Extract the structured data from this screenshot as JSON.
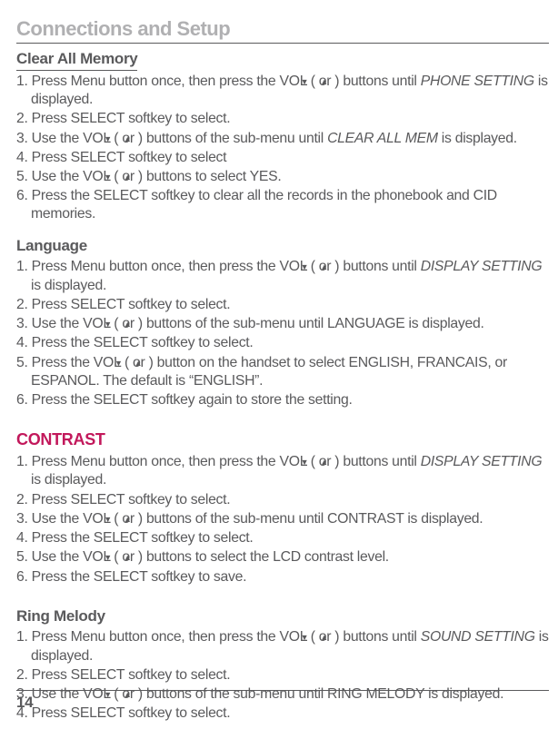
{
  "header": "Connections and Setup",
  "sections": {
    "clearAllMemory": {
      "title": "Clear All Memory",
      "step1a": "1. Press Menu button once, then press the VOL (",
      "step1b": ") buttons until ",
      "step1c": "PHONE SETTING",
      "step1d": " is displayed.",
      "step2": "2. Press SELECT softkey to select.",
      "step3a": "3. Use the VOL (",
      "step3b": ") buttons of the sub-menu until ",
      "step3c": "CLEAR ALL MEM",
      "step3d": " is displayed.",
      "step4": "4. Press SELECT softkey to select",
      "step5a": "5. Use the VOL (",
      "step5b": ") buttons to select YES.",
      "step6": "6. Press the SELECT softkey to clear all the records in the phonebook and CID memories."
    },
    "language": {
      "title": "Language",
      "step1a": "1. Press Menu button once, then press the VOL (",
      "step1b": ") buttons until ",
      "step1c": "DISPLAY SETTING",
      "step1d": " is displayed.",
      "step2": "2. Press SELECT softkey to select.",
      "step3a": "3. Use the VOL (",
      "step3b": ") buttons of the sub-menu until LANGUAGE is displayed.",
      "step4": "4. Press the SELECT softkey to select.",
      "step5a": "5. Press the VOL (",
      "step5b": ") button on the handset to select ENGLISH, FRANCAIS, or ESPANOL. The default is “ENGLISH”.",
      "step6": "6. Press the SELECT softkey again to store the setting."
    },
    "contrast": {
      "title": "CONTRAST",
      "step1a": "1. Press Menu button once, then press the VOL (",
      "step1b": ") buttons until ",
      "step1c": "DISPLAY SETTING",
      "step1d": " is displayed.",
      "step2": "2. Press SELECT softkey to select.",
      "step3a": "3. Use the VOL (",
      "step3b": ") buttons of the sub-menu until CONTRAST is displayed.",
      "step4": "4. Press the SELECT softkey to select.",
      "step5a": "5. Use the VOL (",
      "step5b": ") buttons to select the LCD contrast level.",
      "step6": "6. Press the SELECT softkey to save."
    },
    "ringMelody": {
      "title": "Ring Melody",
      "step1a": "1. Press Menu button once, then press the VOL (",
      "step1b": ") buttons until ",
      "step1c": "SOUND SETTING",
      "step1d": " is displayed.",
      "step2": "2. Press SELECT softkey to select.",
      "step3a": "3. Use the VOL (",
      "step3b": ") buttons of the sub-menu until RING MELODY is displayed.",
      "step4": "4. Press SELECT softkey to select."
    }
  },
  "arrows": {
    "down": "▼",
    "up": "▲",
    "or": " or "
  },
  "pageNumber": "14"
}
